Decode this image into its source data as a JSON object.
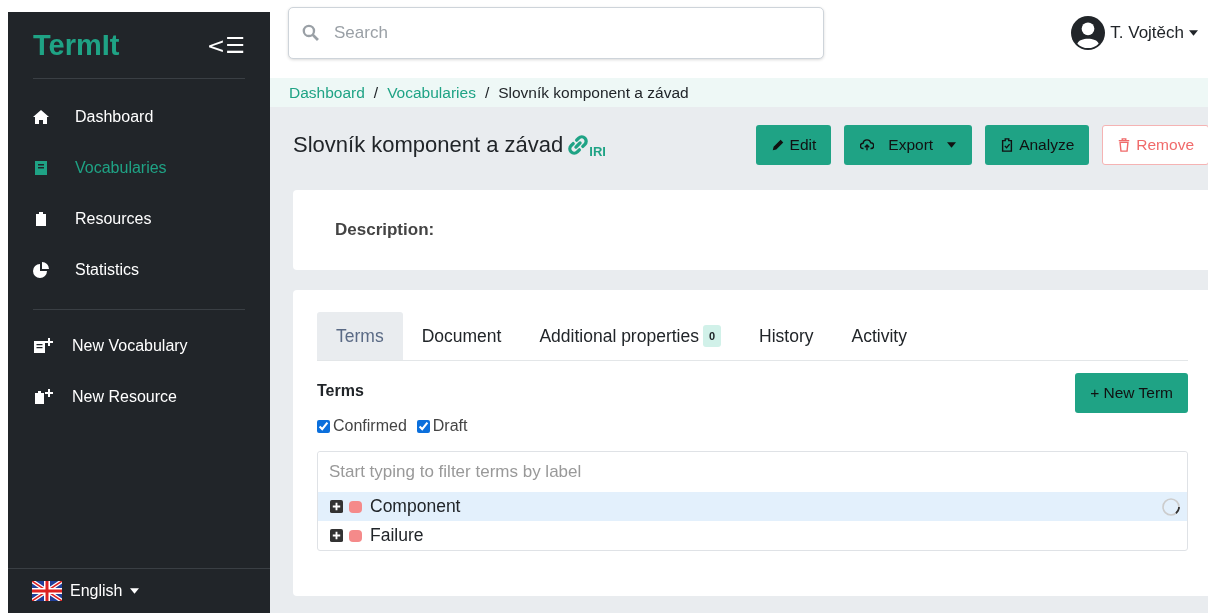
{
  "sidebar": {
    "logo": "TermIt",
    "toggle": "<☰",
    "nav": [
      {
        "label": "Dashboard",
        "selected": false
      },
      {
        "label": "Vocabularies",
        "selected": true
      },
      {
        "label": "Resources",
        "selected": false
      },
      {
        "label": "Statistics",
        "selected": false
      }
    ],
    "actions": [
      {
        "label": "New Vocabulary"
      },
      {
        "label": "New Resource"
      }
    ],
    "language": "English"
  },
  "header": {
    "search": {
      "placeholder": "Search"
    },
    "user": "T. Vojtěch"
  },
  "breadcrumb": [
    {
      "label": "Dashboard",
      "link": true
    },
    {
      "separator": "/",
      "label": "Vocabularies",
      "link": true
    },
    {
      "separator": "/",
      "label": "Slovník komponent a závad",
      "link": false
    }
  ],
  "title": "Slovník komponent a závad",
  "iri_label": "IRI",
  "buttons": [
    {
      "label": "Edit",
      "kind": "edit"
    },
    {
      "label": "Export",
      "kind": "export"
    },
    {
      "label": "Analyze",
      "kind": "analyze"
    },
    {
      "label": "Remove",
      "kind": "remove"
    }
  ],
  "description_label": "Description:",
  "tabs": [
    {
      "label": "Terms",
      "selected": true
    },
    {
      "label": "Document",
      "selected": false
    },
    {
      "label": "Additional properties",
      "badge": "0",
      "selected": false
    },
    {
      "label": "History",
      "selected": false
    },
    {
      "label": "Activity",
      "selected": false
    }
  ],
  "terms": {
    "heading": "Terms",
    "new_button": "+ New Term",
    "filters": [
      {
        "label": "Confirmed",
        "checked": true
      },
      {
        "label": "Draft",
        "checked": true
      }
    ],
    "filter": {
      "placeholder": "Start typing to filter terms by label"
    },
    "items": [
      {
        "label": "Component",
        "selected": true,
        "loading": true
      },
      {
        "label": "Failure",
        "selected": false,
        "loading": false
      }
    ]
  }
}
